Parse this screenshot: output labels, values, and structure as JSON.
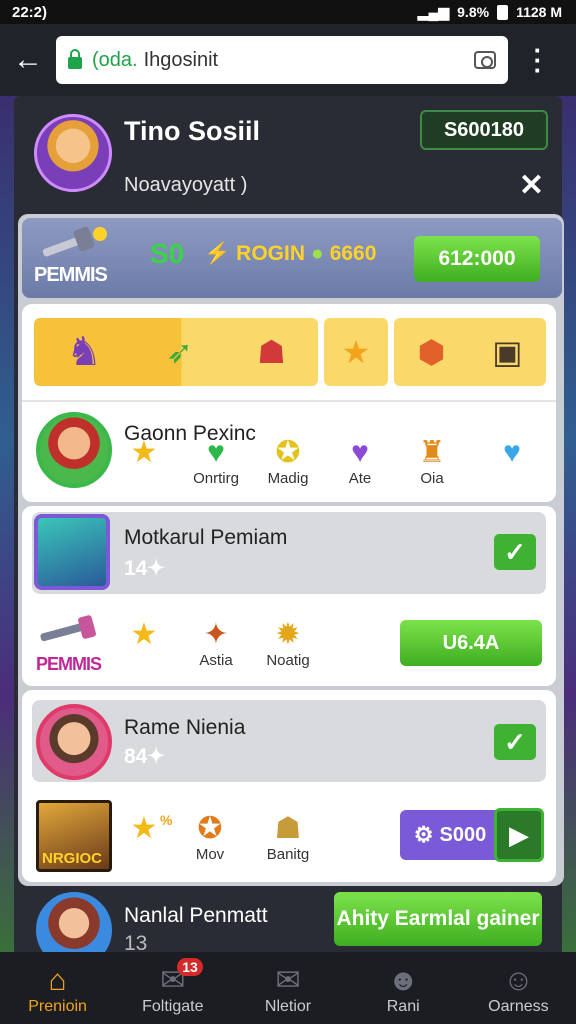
{
  "status_bar": {
    "time": "22:2)",
    "battery": "9.8%",
    "clock": "1128 M"
  },
  "browser": {
    "url_prefix": "(oda.",
    "url_text": "Ihgosinit"
  },
  "profile": {
    "name": "Tino Sosiil",
    "subtitle": "Noavayoyatt )",
    "coins": "S600180"
  },
  "promo": {
    "label": "PEMMIS",
    "value": "S0",
    "bar_text": "ROGIN",
    "bar_num": "6660",
    "button": "612:000"
  },
  "card1": {
    "title": "Gaonn Pexinc",
    "icons": [
      {
        "glyph": "★",
        "label": "",
        "color": "#f5b915"
      },
      {
        "glyph": "♥",
        "label": "Onrtirg",
        "color": "#2fb84a"
      },
      {
        "glyph": "✪",
        "label": "Madig",
        "color": "#e3c21a"
      },
      {
        "glyph": "♥",
        "label": "Ate",
        "color": "#8a4ad6"
      },
      {
        "glyph": "♜",
        "label": "Oia",
        "color": "#e08a1a"
      },
      {
        "glyph": "♥",
        "label": "",
        "color": "#3aa8e8"
      }
    ]
  },
  "card2": {
    "title": "Motkarul Pemiam",
    "count": "14",
    "label2": "PEMMIS",
    "icons": [
      {
        "glyph": "★",
        "label": "",
        "color": "#f5b915"
      },
      {
        "glyph": "✦",
        "label": "Astia",
        "color": "#c8561e"
      },
      {
        "glyph": "✹",
        "label": "Noatig",
        "color": "#e3a81a"
      }
    ],
    "button": "U6.4A"
  },
  "card3": {
    "title": "Rame Nienia",
    "count": "84",
    "label2": "NRGIOC",
    "icons": [
      {
        "glyph": "★",
        "label": "",
        "color": "#f5b915"
      },
      {
        "glyph": "✪",
        "label": "Mov",
        "color": "#e07a1a"
      },
      {
        "glyph": "☗",
        "label": "Banitg",
        "color": "#c79a3a"
      }
    ],
    "badge_pct": "%",
    "button": "S000"
  },
  "bottom": {
    "title": "Nanlal Penmatt",
    "count": "13",
    "button": "Ahity Earmlal gainer"
  },
  "tabs": [
    {
      "label": "Prenioin",
      "icon": "home-icon",
      "glyph": "⌂"
    },
    {
      "label": "Foltigate",
      "icon": "chat-icon",
      "glyph": "✉",
      "badge": "13"
    },
    {
      "label": "Nletior",
      "icon": "mail-icon",
      "glyph": "✉"
    },
    {
      "label": "Rani",
      "icon": "friends-icon",
      "glyph": "☻"
    },
    {
      "label": "Oarness",
      "icon": "profile-icon",
      "glyph": "☺"
    }
  ]
}
